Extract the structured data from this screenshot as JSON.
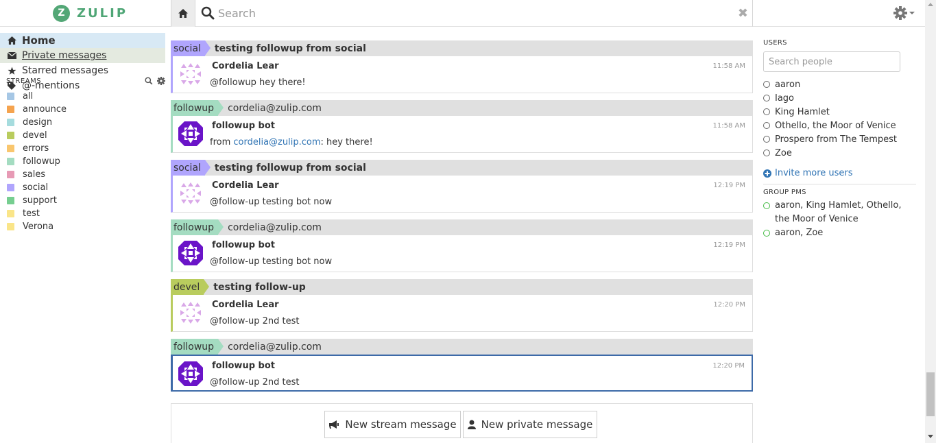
{
  "app": {
    "logo_text": "ZULIP",
    "logo_letter": "Z"
  },
  "search": {
    "placeholder": "Search"
  },
  "nav": {
    "home": "Home",
    "private_messages": "Private messages",
    "starred": "Starred messages",
    "mentions": "@-mentions"
  },
  "streams": {
    "title": "STREAMS",
    "items": [
      {
        "name": "all",
        "color": "#a6c7e5"
      },
      {
        "name": "announce",
        "color": "#f5a34e"
      },
      {
        "name": "design",
        "color": "#a6dcde"
      },
      {
        "name": "devel",
        "color": "#b9cc5e"
      },
      {
        "name": "errors",
        "color": "#f9c66e"
      },
      {
        "name": "followup",
        "color": "#a4dcc1"
      },
      {
        "name": "sales",
        "color": "#e79ab5"
      },
      {
        "name": "social",
        "color": "#b0a5fd"
      },
      {
        "name": "support",
        "color": "#76ce90"
      },
      {
        "name": "test",
        "color": "#fae589"
      },
      {
        "name": "Verona",
        "color": "#fae589"
      }
    ]
  },
  "messages": [
    {
      "stream": "social",
      "stream_color": "#b0a5fd",
      "topic": "testing followup from social",
      "sender": "Cordelia Lear",
      "time": "11:58 AM",
      "content": "@followup hey there!",
      "avatar": "cordelia"
    },
    {
      "stream": "followup",
      "stream_color": "#a4dcc1",
      "topic": "cordelia@zulip.com",
      "sender": "followup bot",
      "time": "11:58 AM",
      "content_prefix": "from ",
      "content_link": "cordelia@zulip.com",
      "content_suffix": ": hey there!",
      "avatar": "bot"
    },
    {
      "stream": "social",
      "stream_color": "#b0a5fd",
      "topic": "testing followup from social",
      "sender": "Cordelia Lear",
      "time": "12:19 PM",
      "content": "@follow-up testing bot now",
      "avatar": "cordelia"
    },
    {
      "stream": "followup",
      "stream_color": "#a4dcc1",
      "topic": "cordelia@zulip.com",
      "sender": "followup bot",
      "time": "12:19 PM",
      "content": "@follow-up testing bot now",
      "avatar": "bot"
    },
    {
      "stream": "devel",
      "stream_color": "#b9cc5e",
      "topic": "testing follow-up",
      "sender": "Cordelia Lear",
      "time": "12:20 PM",
      "content": "@follow-up 2nd test",
      "avatar": "cordelia"
    },
    {
      "stream": "followup",
      "stream_color": "#a4dcc1",
      "topic": "cordelia@zulip.com",
      "sender": "followup bot",
      "time": "12:20 PM",
      "content": "@follow-up 2nd test",
      "avatar": "bot",
      "selected": true
    }
  ],
  "compose": {
    "new_stream": "New stream message",
    "new_private": "New private message"
  },
  "users": {
    "title": "USERS",
    "search_placeholder": "Search people",
    "list": [
      "aaron",
      "Iago",
      "King Hamlet",
      "Othello, the Moor of Venice",
      "Prospero from The Tempest",
      "Zoe"
    ],
    "invite": "Invite more users"
  },
  "group_pms": {
    "title": "GROUP PMS",
    "list": [
      "aaron, King Hamlet, Othello, the Moor of Venice",
      "aaron, Zoe"
    ]
  }
}
